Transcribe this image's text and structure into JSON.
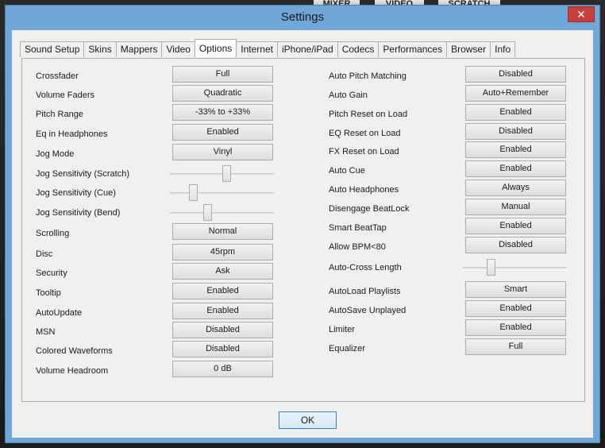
{
  "window": {
    "title": "Settings",
    "close_glyph": "✕"
  },
  "background": {
    "labels": [
      "MIXER",
      "VIDEO",
      "SCRATCH"
    ]
  },
  "tabs": [
    {
      "label": "Sound Setup"
    },
    {
      "label": "Skins"
    },
    {
      "label": "Mappers"
    },
    {
      "label": "Video"
    },
    {
      "label": "Options",
      "active": true
    },
    {
      "label": "Internet"
    },
    {
      "label": "iPhone/iPad"
    },
    {
      "label": "Codecs"
    },
    {
      "label": "Performances"
    },
    {
      "label": "Browser"
    },
    {
      "label": "Info"
    }
  ],
  "left_settings": [
    {
      "label": "Crossfader",
      "control": "button",
      "value": "Full"
    },
    {
      "label": "Volume Faders",
      "control": "button",
      "value": "Quadratic"
    },
    {
      "label": "Pitch Range",
      "control": "button",
      "value": "-33% to +33%"
    },
    {
      "label": "Eq in Headphones",
      "control": "button",
      "value": "Enabled"
    },
    {
      "label": "Jog Mode",
      "control": "button",
      "value": "Vinyl"
    },
    {
      "label": "Jog Sensitivity (Scratch)",
      "control": "slider",
      "value": 0.55
    },
    {
      "label": "Jog Sensitivity (Cue)",
      "control": "slider",
      "value": 0.2
    },
    {
      "label": "Jog Sensitivity (Bend)",
      "control": "slider",
      "value": 0.35
    },
    {
      "label": "Scrolling",
      "control": "button",
      "value": "Normal"
    },
    {
      "label": "Disc",
      "control": "button",
      "value": "45rpm"
    },
    {
      "label": "Security",
      "control": "button",
      "value": "Ask"
    },
    {
      "label": "Tooltip",
      "control": "button",
      "value": "Enabled"
    },
    {
      "label": "AutoUpdate",
      "control": "button",
      "value": "Enabled"
    },
    {
      "label": "MSN",
      "control": "button",
      "value": "Disabled"
    },
    {
      "label": "Colored Waveforms",
      "control": "button",
      "value": "Disabled"
    },
    {
      "label": "Volume Headroom",
      "control": "button",
      "value": "0 dB"
    }
  ],
  "right_settings": [
    {
      "label": "Auto Pitch Matching",
      "control": "button",
      "value": "Disabled"
    },
    {
      "label": "Auto Gain",
      "control": "button",
      "value": "Auto+Remember"
    },
    {
      "label": "Pitch Reset on Load",
      "control": "button",
      "value": "Enabled"
    },
    {
      "label": "EQ Reset on Load",
      "control": "button",
      "value": "Disabled"
    },
    {
      "label": "FX Reset on Load",
      "control": "button",
      "value": "Enabled"
    },
    {
      "label": "Auto Cue",
      "control": "button",
      "value": "Enabled"
    },
    {
      "label": "Auto Headphones",
      "control": "button",
      "value": "Always"
    },
    {
      "label": "Disengage BeatLock",
      "control": "button",
      "value": "Manual"
    },
    {
      "label": "Smart BeatTap",
      "control": "button",
      "value": "Enabled"
    },
    {
      "label": "Allow BPM<80",
      "control": "button",
      "value": "Disabled"
    },
    {
      "label": "Auto-Cross Length",
      "control": "slider",
      "value": 0.25
    },
    {
      "label": "AutoLoad Playlists",
      "control": "button",
      "value": "Smart"
    },
    {
      "label": "AutoSave Unplayed",
      "control": "button",
      "value": "Enabled"
    },
    {
      "label": "Limiter",
      "control": "button",
      "value": "Enabled"
    },
    {
      "label": "Equalizer",
      "control": "button",
      "value": "Full"
    }
  ],
  "ok_label": "OK"
}
